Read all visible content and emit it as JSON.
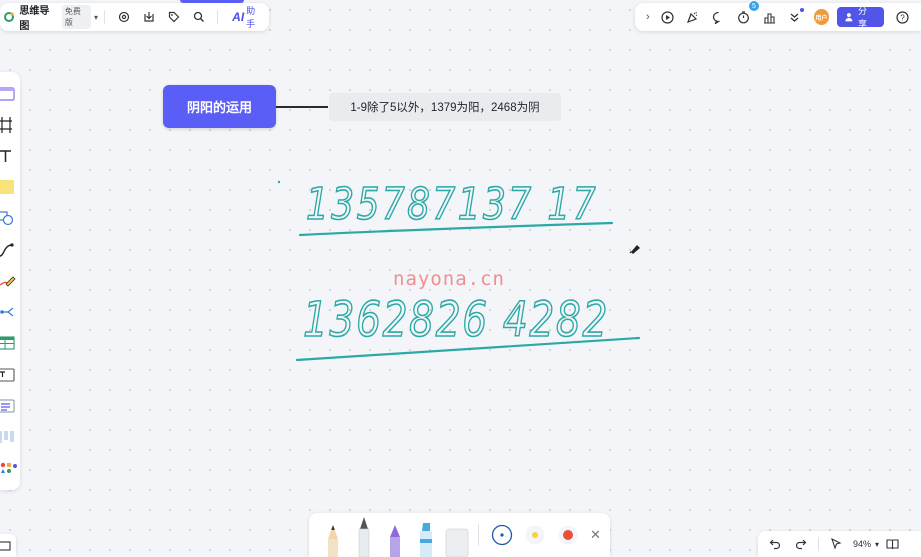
{
  "app": {
    "title": "思维导图",
    "plan_badge": "免费版",
    "ai_logo": "AI",
    "ai_label": "助手"
  },
  "topbar_right": {
    "avatar_text": "用户",
    "share_label": "分享",
    "notification_count": "5"
  },
  "mindmap": {
    "root_label": "阴阳的运用",
    "child_label": "1-9除了5以外，1379为阳，2468为阴"
  },
  "handwriting": {
    "line1": "135787137 17",
    "line2": "1362826 4282"
  },
  "watermark": "nayona.cn",
  "draw_toolbar": {
    "colors": [
      "#1d57a6",
      "#f5d23a",
      "#e8503a"
    ]
  },
  "zoom": {
    "level": "94%"
  },
  "colors": {
    "accent": "#5b5ef6",
    "ink": "#2aa9a6",
    "share_button": "#5156e8"
  }
}
